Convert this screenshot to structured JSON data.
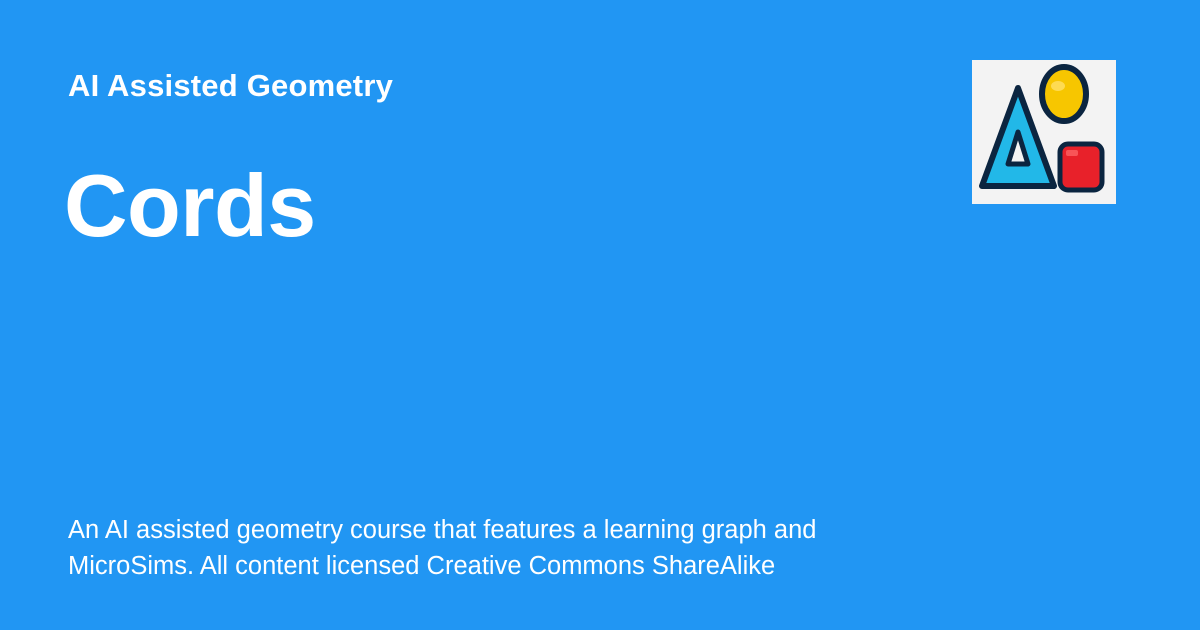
{
  "header": {
    "site_name": "AI Assisted Geometry"
  },
  "page": {
    "title": "Cords",
    "description": "An AI assisted geometry course that features a learning graph and\nMicroSims.  All content licensed Creative Commons ShareAlike"
  },
  "logo": {
    "icon": "geometry-shapes-icon",
    "colors": {
      "background": "#f3f3f3",
      "triangle": "#22b8e8",
      "circle": "#f7c600",
      "square": "#e8212a",
      "outline": "#0b2540"
    }
  }
}
